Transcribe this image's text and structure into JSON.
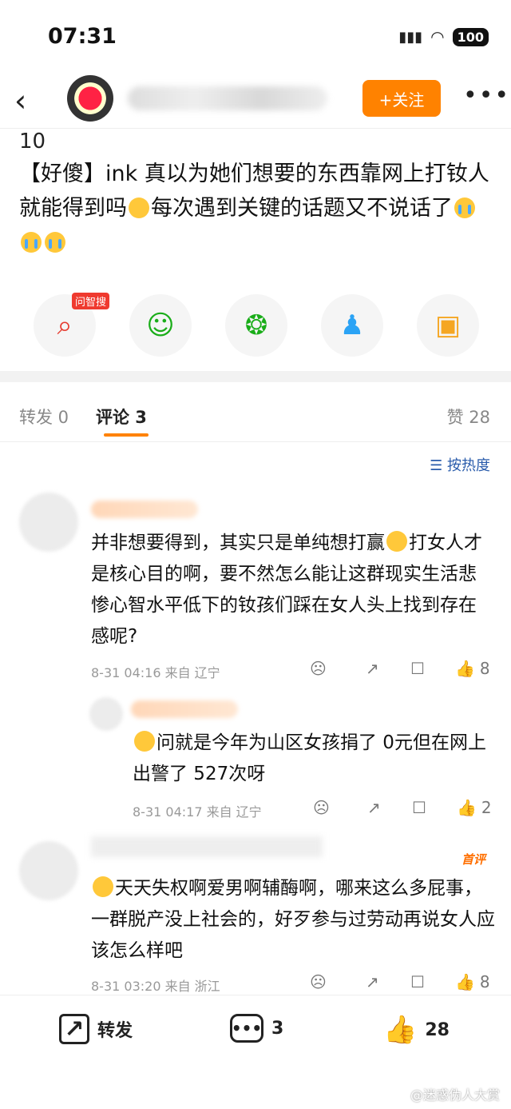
{
  "status": {
    "time": "07:31",
    "battery": "100"
  },
  "header": {
    "follow_label": "+关注",
    "more": "•••"
  },
  "post": {
    "number": "10",
    "text_part1": "【好傻】ink 真以为她们想要的东西靠网上打钕人就能得到吗",
    "text_part2": "每次遇到关键的话题又不说话了"
  },
  "share": {
    "badge": "问智搜"
  },
  "tabs": {
    "repost": "转发 0",
    "comment": "评论 3",
    "like": "赞 28"
  },
  "sort_label": "按热度",
  "comments": [
    {
      "text": "并非想要得到，其实只是单纯想打赢",
      "text2": "打女人才是核心目的啊，要不然怎么能让这群现实生活悲惨心智水平低下的钕孩们踩在女人头上找到存在感呢?",
      "meta": "8-31 04:16  来自 辽宁",
      "likes": "8"
    },
    {
      "text": "问就是今年为山区女孩捐了 0元但在网上出警了 527次呀",
      "meta": "8-31 04:17  来自 辽宁",
      "likes": "2"
    },
    {
      "tag": "首评",
      "text": "天天失权啊爱男啊辅酶啊，哪来这么多屁事，一群脱产没上社会的，好歹参与过劳动再说女人应该怎么样吧",
      "meta": "8-31 03:20  来自 浙江",
      "likes": "8"
    }
  ],
  "bottom": {
    "repost": "转发",
    "comments": "3",
    "likes": "28"
  },
  "watermark": "@迷惑伪人大赏"
}
